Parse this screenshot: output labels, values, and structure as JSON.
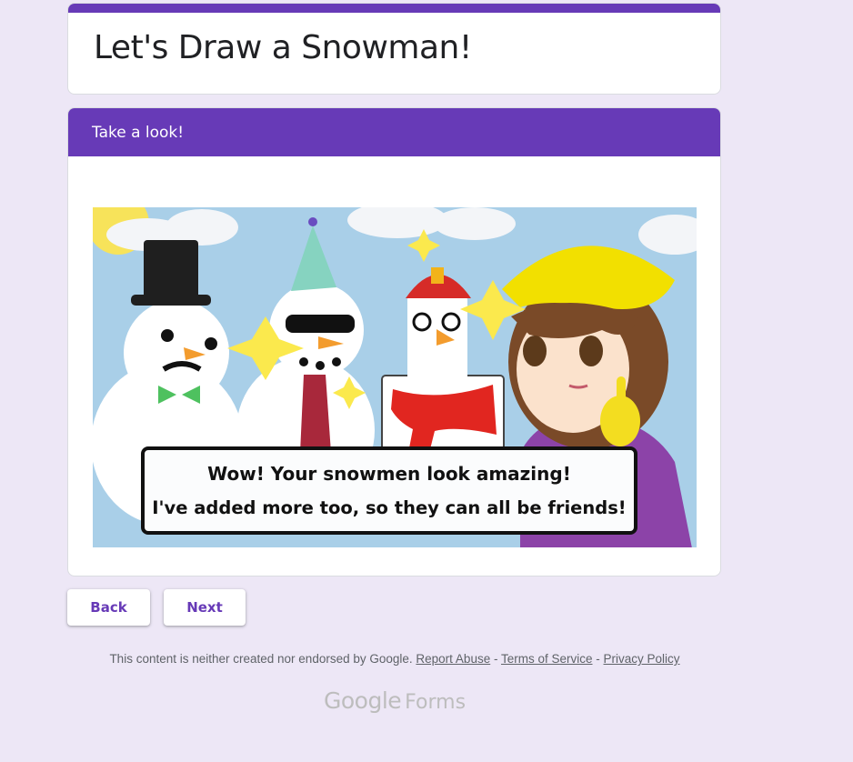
{
  "form": {
    "title": "Let's Draw a Snowman!",
    "accent_color": "#673ab7",
    "background_color": "#ede7f6"
  },
  "section": {
    "title": "Take a look!",
    "image": {
      "speech_line1": "Wow! Your snowmen look amazing!",
      "speech_line2": "I've added more too, so they can all be friends!"
    }
  },
  "buttons": {
    "back": "Back",
    "next": "Next"
  },
  "footer": {
    "disclaimer": "This content is neither created nor endorsed by Google.",
    "report_abuse": "Report Abuse",
    "separator": " - ",
    "terms": "Terms of Service",
    "privacy": "Privacy Policy",
    "brand_google": "Google",
    "brand_forms": "Forms"
  }
}
